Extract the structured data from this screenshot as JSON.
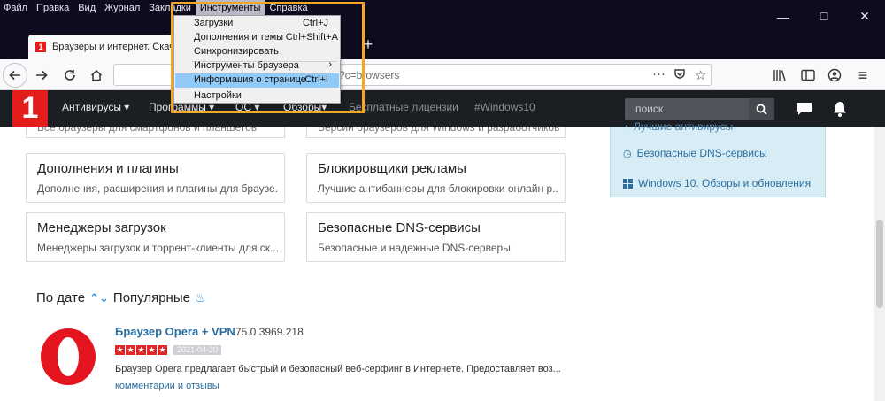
{
  "menubar": {
    "items": [
      "Файл",
      "Правка",
      "Вид",
      "Журнал",
      "Закладки",
      "Инструменты",
      "Справка"
    ],
    "active_index": 5
  },
  "window_controls": {
    "minimize": "—",
    "maximize": "☐",
    "close": "✕"
  },
  "tab": {
    "title": "Браузеры и интернет. Скачать"
  },
  "url": {
    "visible_text": "?c=browsers"
  },
  "dropdown": {
    "items": [
      {
        "label": "Загрузки",
        "shortcut": "Ctrl+J"
      },
      {
        "label": "Дополнения и темы",
        "shortcut": "Ctrl+Shift+A"
      },
      {
        "label": "Синхронизировать",
        "shortcut": ""
      },
      {
        "label": "Инструменты браузера",
        "shortcut": "",
        "submenu": true
      },
      {
        "label": "Информация о странице",
        "shortcut": "Ctrl+I",
        "highlighted": true
      },
      {
        "label": "Настройки",
        "shortcut": ""
      }
    ]
  },
  "site": {
    "logo": "1",
    "nav": [
      "Антивирусы",
      "Программы",
      "ОС",
      "Обзоры",
      "Бесплатные лицензии",
      "#Windows10"
    ],
    "search_placeholder": "поиск"
  },
  "cards_partial": [
    "Все браузеры для смартфонов и планшетов",
    "Версии браузеров для Windows и разработчиков"
  ],
  "cards": [
    {
      "title": "Дополнения и плагины",
      "desc": "Дополнения, расширения и плагины для браузе..."
    },
    {
      "title": "Блокировщики рекламы",
      "desc": "Лучшие антибаннеры для блокировки онлайн р..."
    },
    {
      "title": "Менеджеры загрузок",
      "desc": "Менеджеры загрузок и торрент-клиенты для ск..."
    },
    {
      "title": "Безопасные DNS-сервисы",
      "desc": "Безопасные и надежные DNS-серверы"
    }
  ],
  "sidebar": {
    "partial_link": "Лучшие антивирусы",
    "links": [
      "Безопасные DNS-сервисы",
      "Windows 10. Обзоры и обновления"
    ]
  },
  "sort": {
    "by_date": "По дате",
    "popular": "Популярные"
  },
  "app": {
    "name": "Браузер Opera + VPN",
    "version": "75.0.3969.218",
    "rating": 5,
    "date": "2021-04-20",
    "description": "Браузер Opera предлагает быстрый и безопасный веб-серфинг в Интернете. Предоставляет воз...",
    "comments": "комментарии и отзывы"
  },
  "colors": {
    "accent_red": "#e31c1c",
    "link_blue": "#2a6fa0",
    "menu_highlight": "#91c9f7",
    "frame_orange": "#f5a623"
  }
}
